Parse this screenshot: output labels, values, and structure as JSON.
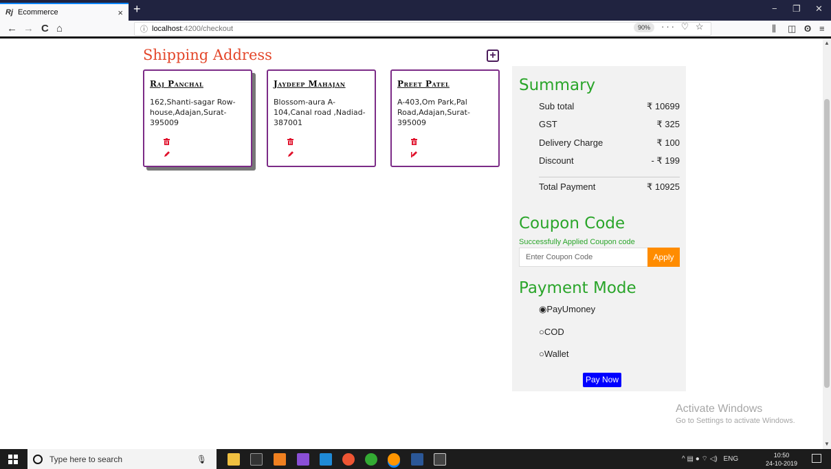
{
  "browser": {
    "tab_title": "Ecommerce",
    "tab_favicon": "Rj",
    "tab_close": "×",
    "new_tab": "+",
    "url_host": "localhost",
    "url_path": ":4200/checkout",
    "zoom": "90%",
    "page_actions": "··· ♡ ☆",
    "nav": {
      "back": "←",
      "forward": "→",
      "reload": "C",
      "home": "⌂"
    },
    "window_controls": {
      "minimize": "−",
      "restore": "❐",
      "close": "✕"
    },
    "toolbar_icons": {
      "library": "⫼",
      "sidebar": "◫",
      "account": "ʘ",
      "menu": "≡"
    }
  },
  "shipping": {
    "title": "Shipping Address",
    "add_icon": "+",
    "addresses": [
      {
        "name": "Raj Panchal",
        "address": "162,Shanti-sagar Row-house,Adajan,Surat-395009"
      },
      {
        "name": "Jaydeep Mahajan",
        "address": "Blossom-aura A-104,Canal road ,Nadiad-387001"
      },
      {
        "name": "Preet Patel",
        "address": "A-403,Om Park,Pal Road,Adajan,Surat-395009"
      }
    ]
  },
  "summary": {
    "title": "Summary",
    "rows": [
      {
        "label": "Sub total",
        "value": "₹ 10699"
      },
      {
        "label": "GST",
        "value": "₹ 325"
      },
      {
        "label": "Delivery Charge",
        "value": "₹ 100"
      },
      {
        "label": "Discount",
        "value": "-  ₹ 199"
      }
    ],
    "total_label": "Total Payment",
    "total_value": "₹ 10925"
  },
  "coupon": {
    "title": "Coupon Code",
    "message": "Successfully Applied Coupon code",
    "placeholder": "Enter Coupon Code",
    "apply_label": "Apply"
  },
  "payment": {
    "title": "Payment Mode",
    "options": [
      {
        "label": "PayUmoney",
        "selected": true,
        "mark": "◉"
      },
      {
        "label": "COD",
        "selected": false,
        "mark": "○"
      },
      {
        "label": "Wallet",
        "selected": false,
        "mark": "○"
      }
    ],
    "pay_label": "Pay Now"
  },
  "watermark": {
    "line1": "Activate Windows",
    "line2": "Go to Settings to activate Windows."
  },
  "taskbar": {
    "search_placeholder": "Type here to search",
    "language": "ENG",
    "time": "10:50",
    "date": "24-10-2019",
    "tray_icons": "^ ▤ ● ⌔ ◁)"
  },
  "colors": {
    "shipping_title": "#e3472b",
    "card_border": "#7b2a86",
    "heading_green": "#2aa52a",
    "apply_button": "#ff8c00",
    "pay_button": "#0000ff",
    "icon_red": "#e0112b"
  }
}
